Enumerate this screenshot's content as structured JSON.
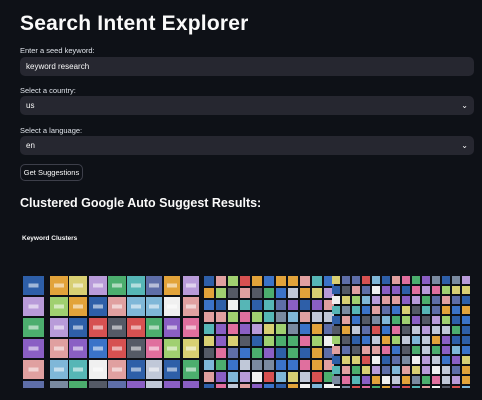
{
  "app": {
    "title": "Search Intent Explorer"
  },
  "keyword": {
    "label": "Enter a seed keyword:",
    "value": "keyword research"
  },
  "country": {
    "label": "Select a country:",
    "value": "us"
  },
  "language": {
    "label": "Select a language:",
    "value": "en"
  },
  "button": {
    "label": "Get Suggestions"
  },
  "results": {
    "heading": "Clustered Google Auto Suggest Results:",
    "chart_title": "Keyword Clusters"
  },
  "palette": [
    "#3b73c8",
    "#e2a33a",
    "#4cae6e",
    "#d65151",
    "#8a5fc4",
    "#7fb7d8",
    "#c0c8d8",
    "#e0a0a0",
    "#2e5fa8",
    "#5e6ea8",
    "#b89bd9",
    "#d8cf73",
    "#56b6b6",
    "#e06f9e",
    "#7a8aa0",
    "#a0d070",
    "#f0f0f0",
    "#555a66"
  ],
  "icons": {
    "chevron": "chevron-down-icon"
  }
}
